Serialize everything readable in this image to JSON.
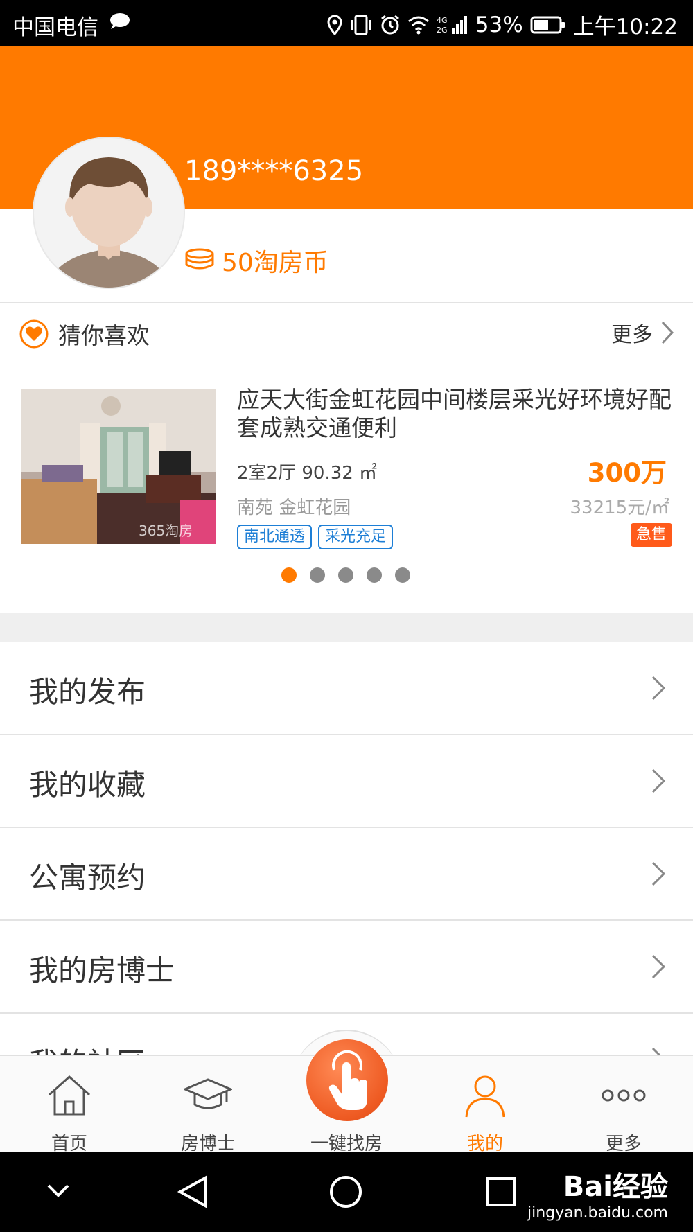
{
  "status_bar": {
    "carrier": "中国电信",
    "battery": "53%",
    "time": "上午10:22"
  },
  "profile": {
    "phone": "189****6325",
    "coins": "50淘房币"
  },
  "recommend": {
    "title": "猜你喜欢",
    "more": "更多",
    "listing": {
      "title": "应天大街金虹花园中间楼层采光好环境好配套成熟交通便利",
      "specs": "2室2厅 90.32 ㎡",
      "price_value": "300",
      "price_unit": "万",
      "area": "南苑 金虹花园",
      "unit_price": "33215元/㎡",
      "tags": [
        "南北通透",
        "采光充足"
      ],
      "badge": "急售",
      "photo_watermark": "365淘房"
    },
    "carousel": {
      "pages": 5,
      "active": 0
    }
  },
  "menu": [
    {
      "label": "我的发布"
    },
    {
      "label": "我的收藏"
    },
    {
      "label": "公寓预约"
    },
    {
      "label": "我的房博士"
    },
    {
      "label": "我的社区"
    }
  ],
  "bottom_nav": [
    {
      "label": "首页",
      "icon": "home-icon",
      "active": false
    },
    {
      "label": "房博士",
      "icon": "graduation-cap-icon",
      "active": false
    },
    {
      "label": "一键找房",
      "icon": "tap-hand-icon",
      "active": false
    },
    {
      "label": "我的",
      "icon": "person-icon",
      "active": true
    },
    {
      "label": "更多",
      "icon": "more-dots-icon",
      "active": false
    }
  ],
  "watermark": {
    "brand": "Bai经验",
    "url": "jingyan.baidu.com"
  },
  "colors": {
    "accent": "#ff7a00",
    "tag_blue": "#1e7fd6",
    "urgent": "#ff5a1a"
  }
}
